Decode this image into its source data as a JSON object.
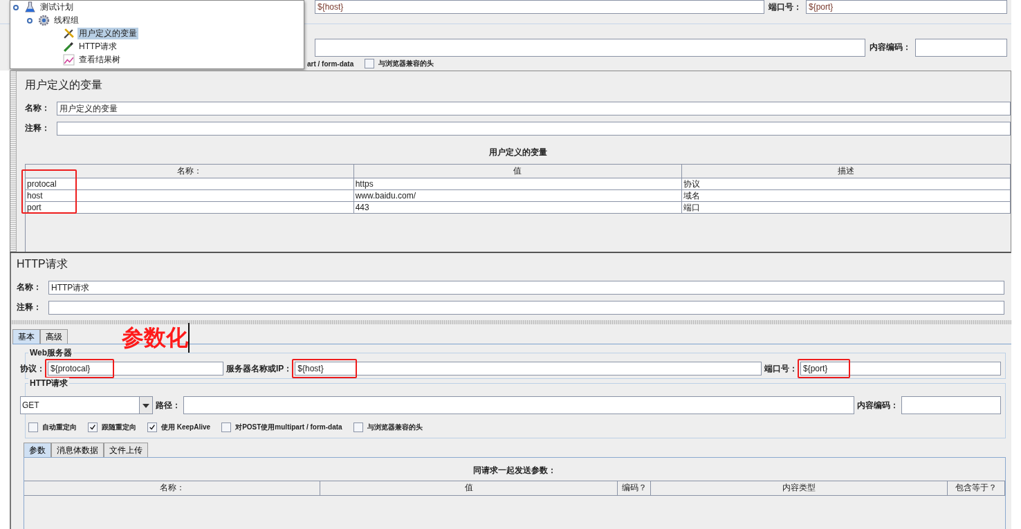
{
  "tree": {
    "items": [
      {
        "label": "测试计划",
        "kind": "plan",
        "selected": false,
        "children": [
          {
            "label": "线程组",
            "kind": "group",
            "selected": false,
            "children": [
              {
                "label": "用户定义的变量",
                "kind": "config",
                "selected": true
              },
              {
                "label": "HTTP请求",
                "kind": "sampler",
                "selected": false
              },
              {
                "label": "查看结果树",
                "kind": "listener",
                "selected": false
              }
            ]
          }
        ]
      }
    ]
  },
  "background_panel": {
    "server_value": "${host}",
    "port_label": "端口号：",
    "port_value": "${port}",
    "encoding_label": "内容编码：",
    "cut_text": "art / form-data",
    "checkbox": {
      "label": "与浏览器兼容的头",
      "checked": false
    }
  },
  "variables_panel": {
    "title": "用户定义的变量",
    "name_label": "名称：",
    "name_value": "用户定义的变量",
    "comment_label": "注释：",
    "table": {
      "title": "用户定义的变量",
      "columns": [
        "名称：",
        "值",
        "描述"
      ],
      "highlight_first_column": true,
      "rows": [
        [
          "protocal",
          "https",
          "协议"
        ],
        [
          "host",
          "www.baidu.com/",
          "域名"
        ],
        [
          "port",
          "443",
          "端口"
        ]
      ]
    }
  },
  "http_panel": {
    "title": "HTTP请求",
    "name_label": "名称：",
    "name_value": "HTTP请求",
    "comment_label": "注释：",
    "tabs": [
      {
        "label": "基本",
        "selected": true
      },
      {
        "label": "高级",
        "selected": false
      }
    ],
    "annotation": "参数化",
    "server_group": {
      "title": "Web服务器",
      "fields": [
        {
          "label": "协议：",
          "value": "${protocal}",
          "highlighted": true
        },
        {
          "label": "服务器名称或IP：",
          "value": "${host}",
          "highlighted": true
        },
        {
          "label": "端口号：",
          "value": "${port}",
          "highlighted": true
        }
      ]
    },
    "request_group": {
      "title": "HTTP请求",
      "method": "GET",
      "path_label": "路径：",
      "encoding_label": "内容编码：",
      "options": [
        {
          "label": "自动重定向",
          "checked": false
        },
        {
          "label": "跟随重定向",
          "checked": true
        },
        {
          "label": "使用 KeepAlive",
          "checked": true
        },
        {
          "label": "对POST使用multipart / form-data",
          "checked": false
        },
        {
          "label": "与浏览器兼容的头",
          "checked": false
        }
      ]
    },
    "sub_tabs": [
      {
        "label": "参数",
        "selected": true
      },
      {
        "label": "消息体数据",
        "selected": false
      },
      {
        "label": "文件上传",
        "selected": false
      }
    ],
    "params_table": {
      "title": "同请求一起发送参数：",
      "columns": [
        "名称：",
        "值",
        "编码？",
        "内容类型",
        "包含等于？"
      ]
    }
  }
}
